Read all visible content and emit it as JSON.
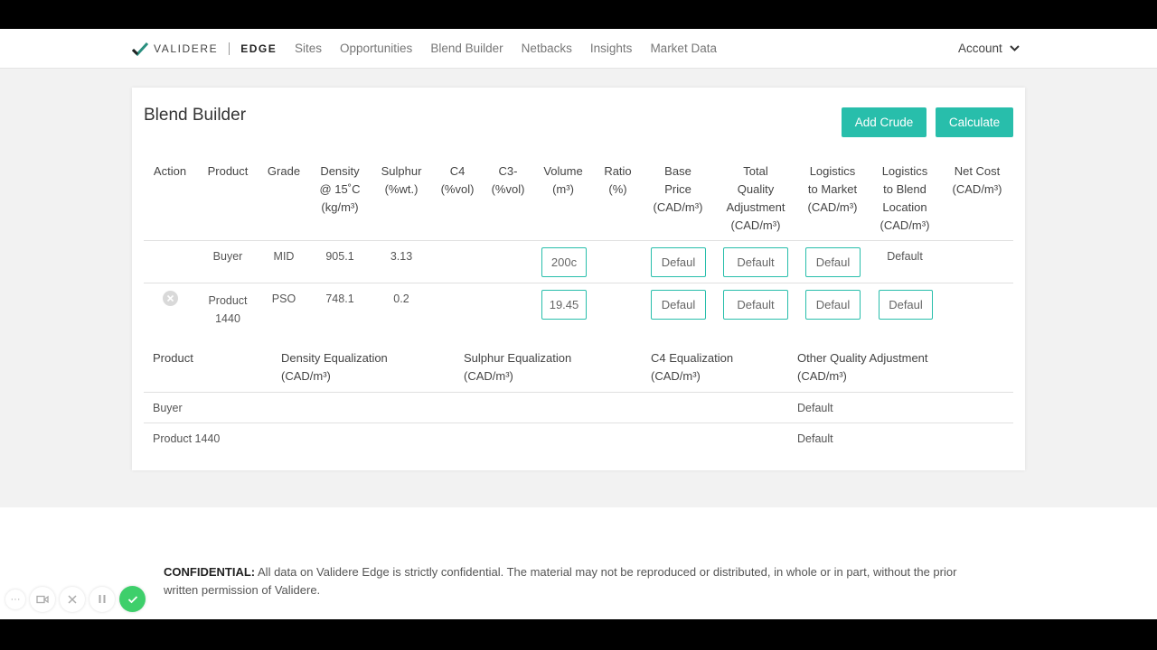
{
  "brand": {
    "name": "VALIDERE",
    "product": "EDGE",
    "accent": "#28beab"
  },
  "nav": [
    "Sites",
    "Opportunities",
    "Blend Builder",
    "Netbacks",
    "Insights",
    "Market Data"
  ],
  "account": {
    "label": "Account",
    "icon": "chevron-down-icon"
  },
  "page": {
    "title": "Blend Builder",
    "add_crude": "Add Crude",
    "calculate": "Calculate"
  },
  "blend_table": {
    "headers": {
      "action": [
        "Action"
      ],
      "product": [
        "Product"
      ],
      "grade": [
        "Grade"
      ],
      "density": [
        "Density",
        "@ 15˚C",
        "(kg/m³)"
      ],
      "sulphur": [
        "Sulphur",
        "(%wt.)"
      ],
      "c4": [
        "C4",
        "(%vol)"
      ],
      "c3": [
        "C3-",
        "(%vol)"
      ],
      "volume": [
        "Volume",
        "(m³)"
      ],
      "ratio": [
        "Ratio",
        "(%)"
      ],
      "base_price": [
        "Base",
        "Price",
        "(CAD/m³)"
      ],
      "tqa": [
        "Total",
        "Quality",
        "Adjustment",
        "(CAD/m³)"
      ],
      "log_market": [
        "Logistics",
        "to Market",
        "(CAD/m³)"
      ],
      "log_blend": [
        "Logistics",
        "to Blend",
        "Location",
        "(CAD/m³)"
      ],
      "net_cost": [
        "Net Cost",
        "(CAD/m³)"
      ]
    },
    "rows": [
      {
        "product": [
          "Buyer"
        ],
        "grade": "MID",
        "density": "905.1",
        "sulphur": "3.13",
        "volume": "200c",
        "base_price": "Defaul",
        "tqa": "Default",
        "log_market": "Defaul",
        "log_blend": "Default"
      },
      {
        "product": [
          "Product",
          "1440"
        ],
        "grade": "PSO",
        "density": "748.1",
        "sulphur": "0.2",
        "volume": "19.45",
        "base_price": "Defaul",
        "tqa": "Default",
        "log_market": "Defaul",
        "log_blend": "Defaul"
      }
    ]
  },
  "quality_table": {
    "headers": {
      "product": [
        "Product"
      ],
      "density_eq": [
        "Density Equalization",
        "(CAD/m³)"
      ],
      "sulphur_eq": [
        "Sulphur Equalization",
        "(CAD/m³)"
      ],
      "c4_eq": [
        "C4 Equalization",
        "(CAD/m³)"
      ],
      "other": [
        "Other Quality Adjustment",
        "(CAD/m³)"
      ]
    },
    "rows": [
      {
        "product": "Buyer",
        "other": "Default"
      },
      {
        "product": "Product 1440",
        "other": "Default"
      }
    ]
  },
  "footer": {
    "label": "CONFIDENTIAL:",
    "text": "All data on Validere Edge is strictly confidential. The material may not be reproduced or distributed, in whole or in part, without the prior written permission of Validere."
  }
}
